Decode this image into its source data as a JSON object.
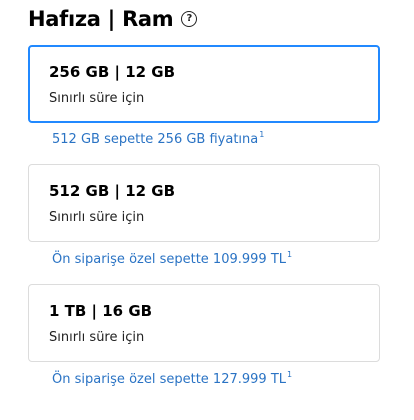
{
  "header": {
    "title": "Hafıza | Ram",
    "help_icon": "question-circle-icon",
    "help_glyph": "?"
  },
  "options": [
    {
      "title": "256 GB | 12 GB",
      "subtitle": "Sınırlı süre için",
      "selected": true,
      "promo": "512 GB sepette 256 GB fiyatına",
      "promo_note": "1"
    },
    {
      "title": "512 GB | 12 GB",
      "subtitle": "Sınırlı süre için",
      "selected": false,
      "promo": "Ön siparişe özel sepette 109.999 TL",
      "promo_note": "1"
    },
    {
      "title": "1 TB | 16 GB",
      "subtitle": "Sınırlı süre için",
      "selected": false,
      "promo": "Ön siparişe özel sepette 127.999 TL",
      "promo_note": "1"
    }
  ],
  "colors": {
    "selected_border": "#2189ff",
    "promo_text": "#2a73c4",
    "default_border": "#dcdcdc"
  }
}
